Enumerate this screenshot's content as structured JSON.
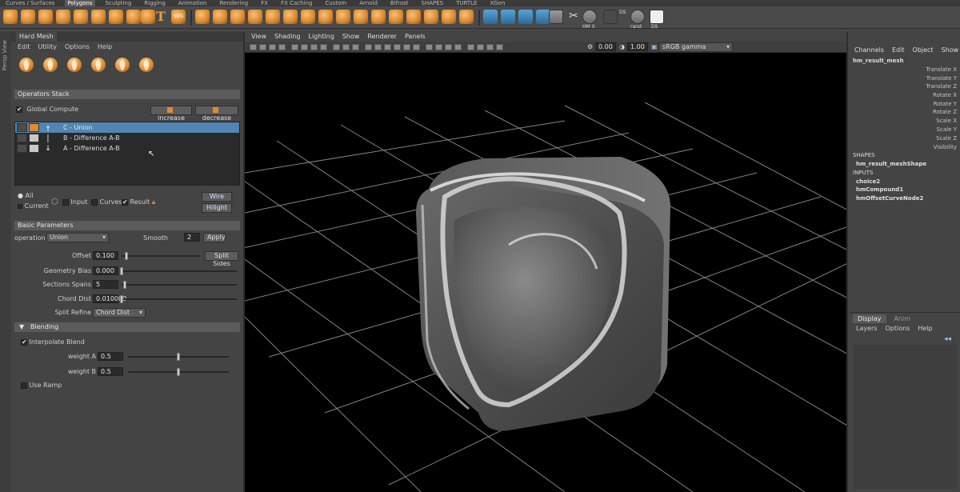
{
  "shelf_tabs": [
    "Curves / Surfaces",
    "Polygons",
    "Sculpting",
    "Rigging",
    "Animation",
    "Rendering",
    "FX",
    "FX Caching",
    "Custom",
    "Arnold",
    "Bifrost",
    "SHAPES",
    "TURTLE",
    "XGen"
  ],
  "shelf_active": "Polygons",
  "shelf_labels": {
    "hm_x": "HM X",
    "rand": "rand",
    "ds1": "DS",
    "ds2": "DS"
  },
  "left_strip": "Persp View",
  "hardmesh": {
    "title": "Hard Mesh",
    "menu": [
      "Edit",
      "Utility",
      "Options",
      "Help"
    ],
    "operators_stack": "Operators Stack",
    "global_compute": "Global Compute",
    "increase": "increase",
    "decrease": "decrease",
    "operators": [
      {
        "label": "C - Union",
        "selected": true
      },
      {
        "label": "B - Difference A-B",
        "selected": false
      },
      {
        "label": "A - Difference A-B",
        "selected": false
      }
    ],
    "all": "All",
    "current": "Current",
    "input": "Input",
    "curves": "Curves",
    "result": "Result",
    "wire": "Wire",
    "hilight": "Hilight",
    "basic_parameters": "Basic Parameters",
    "operation_label": "operation",
    "operation_value": "Union",
    "smooth_label": "Smooth",
    "smooth_value": "2",
    "apply": "Apply",
    "offset_label": "Offset",
    "offset_value": "0.100",
    "split_sides": "Split Sides",
    "geometry_bias_label": "Geometry Bias",
    "geometry_bias_value": "0.000",
    "sections_spans_label": "Sections Spans",
    "sections_spans_value": "5",
    "chord_dist_label": "Chord Dist",
    "chord_dist_value": "0.010000",
    "split_refine_label": "Split Refine",
    "split_refine_value": "Chord Dist",
    "blending": "Blending",
    "interpolate_blend": "Interpolate Blend",
    "weight_a_label": "weight A",
    "weight_a_value": "0.5",
    "weight_b_label": "weight B",
    "weight_b_value": "0.5",
    "use_ramp": "Use Ramp"
  },
  "viewport": {
    "menu": [
      "View",
      "Shading",
      "Lighting",
      "Show",
      "Renderer",
      "Panels"
    ],
    "exposure": "0.00",
    "gamma": "1.00",
    "color_space": "sRGB gamma"
  },
  "channel_box": {
    "menu": [
      "Channels",
      "Edit",
      "Object",
      "Show"
    ],
    "node": "hm_result_mesh",
    "attributes": [
      "Translate X",
      "Translate Y",
      "Translate Z",
      "Rotate X",
      "Rotate Y",
      "Rotate Z",
      "Scale X",
      "Scale Y",
      "Scale Z",
      "Visibility"
    ],
    "shapes_label": "SHAPES",
    "shape": "hm_result_meshShape",
    "inputs_label": "INPUTS",
    "inputs": [
      "choice2",
      "hmCompound1",
      "hmOffsetCurveNode2"
    ]
  },
  "layer_editor": {
    "tabs": [
      "Display",
      "Anim"
    ],
    "menu": [
      "Layers",
      "Options",
      "Help"
    ]
  }
}
